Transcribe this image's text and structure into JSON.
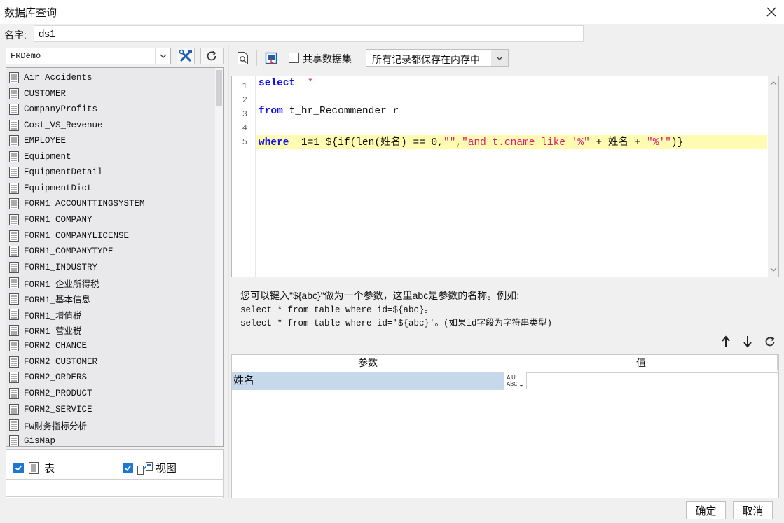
{
  "window": {
    "title": "数据库查询",
    "close_icon": "close-icon"
  },
  "name_row": {
    "label": "名字:",
    "value": "ds1"
  },
  "left_panel": {
    "datasource": "FRDemo",
    "tables": [
      "Air_Accidents",
      "CUSTOMER",
      "CompanyProfits",
      "Cost_VS_Revenue",
      "EMPLOYEE",
      "Equipment",
      "EquipmentDetail",
      "EquipmentDict",
      "FORM1_ACCOUNTTINGSYSTEM",
      "FORM1_COMPANY",
      "FORM1_COMPANYLICENSE",
      "FORM1_COMPANYTYPE",
      "FORM1_INDUSTRY",
      "FORM1_企业所得税",
      "FORM1_基本信息",
      "FORM1_增值税",
      "FORM1_营业税",
      "FORM2_CHANCE",
      "FORM2_CUSTOMER",
      "FORM2_ORDERS",
      "FORM2_PRODUCT",
      "FORM2_SERVICE",
      "FW财务指标分析",
      "GisMap"
    ],
    "show_tables_label": "表",
    "show_views_label": "视图"
  },
  "right_toolbar": {
    "share_label": "共享数据集",
    "memory_option": "所有记录都保存在内存中"
  },
  "editor": {
    "line_numbers": [
      "1",
      "2",
      "3",
      "4",
      "5"
    ],
    "line1_kw": "select",
    "line1_rest": "  *",
    "line3_kw": "from",
    "line3_rest": " t_hr_Recommender r",
    "line5_kw": "where",
    "line5_a": "  1=1 ${if(len(姓名) == 0,",
    "line5_str1": "\"\"",
    "line5_b": ",",
    "line5_str2": "\"and t.cname like '%\"",
    "line5_c": " + 姓名 + ",
    "line5_str3": "\"%'\"",
    "line5_d": ")}"
  },
  "hint": {
    "line1": "您可以键入\"${abc}\"做为一个参数，这里abc是参数的名称。例如:",
    "line2": "select * from table where id=${abc}。",
    "line3": "select * from table where id='${abc}'。(如果id字段为字符串类型)"
  },
  "params": {
    "header_param": "参数",
    "header_value": "值",
    "rows": [
      {
        "name": "姓名",
        "value": ""
      }
    ]
  },
  "footer": {
    "ok": "确定",
    "cancel": "取消"
  }
}
